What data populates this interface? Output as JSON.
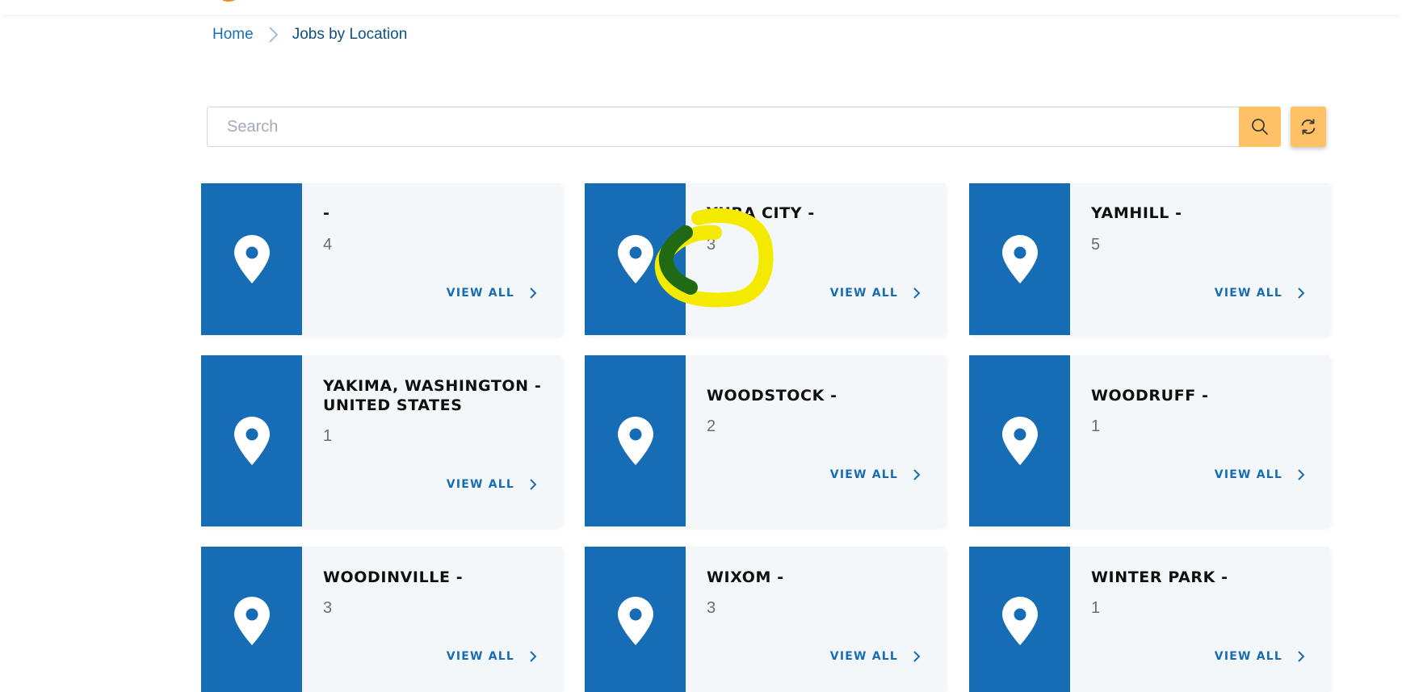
{
  "breadcrumb": {
    "home": "Home",
    "current": "Jobs by Location"
  },
  "search": {
    "placeholder": "Search",
    "value": ""
  },
  "colors": {
    "primary_blue": "#176db5",
    "accent_orange": "#ffc165",
    "card_bg": "#f4f7f9"
  },
  "icons": {
    "card": "map-pin-icon",
    "search": "search-icon",
    "refresh": "refresh-icon",
    "breadcrumb_separator": "chevron-right-icon",
    "view_all": "chevron-right-icon"
  },
  "locations": [
    {
      "name": "-",
      "count": "4",
      "link": "VIEW ALL"
    },
    {
      "name": "YUBA CITY -",
      "count": "3",
      "link": "VIEW ALL"
    },
    {
      "name": "YAMHILL -",
      "count": "5",
      "link": "VIEW ALL"
    },
    {
      "name": "YAKIMA, WASHINGTON - UNITED STATES",
      "count": "1",
      "link": "VIEW ALL"
    },
    {
      "name": "WOODSTOCK -",
      "count": "2",
      "link": "VIEW ALL"
    },
    {
      "name": "WOODRUFF -",
      "count": "1",
      "link": "VIEW ALL"
    },
    {
      "name": "WOODINVILLE -",
      "count": "3",
      "link": "VIEW ALL"
    },
    {
      "name": "WIXOM -",
      "count": "3",
      "link": "VIEW ALL"
    },
    {
      "name": "WINTER PARK -",
      "count": "1",
      "link": "VIEW ALL"
    }
  ]
}
